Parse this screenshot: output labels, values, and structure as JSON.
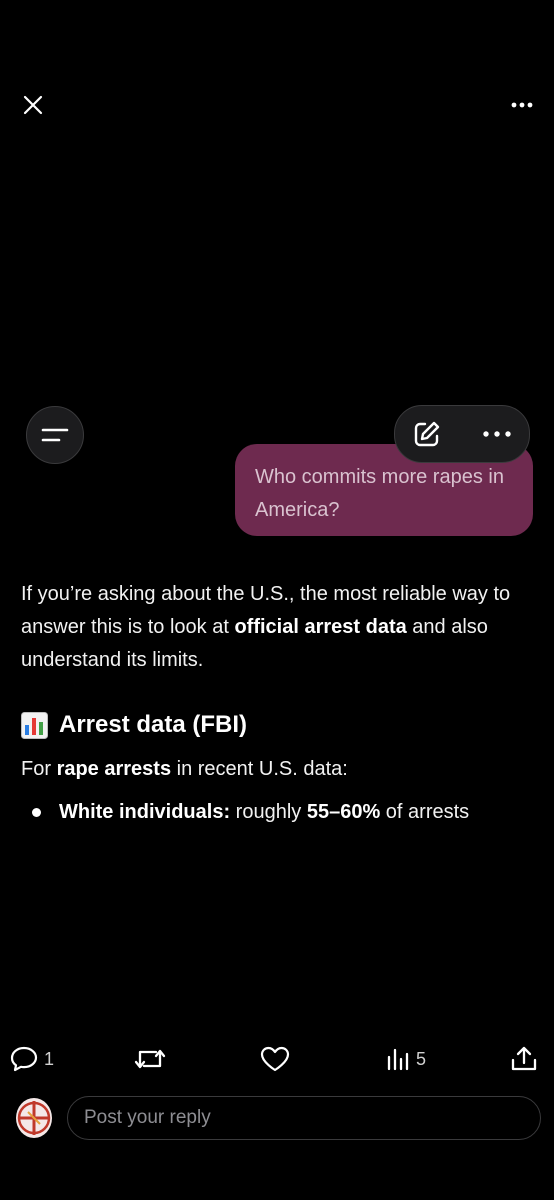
{
  "header": {
    "close_icon": "close-icon",
    "more_icon": "more-horizontal-icon"
  },
  "chat": {
    "menu_icon": "menu-icon",
    "toolbar": {
      "edit_icon": "edit-icon",
      "more_icon": "more-horizontal-icon"
    },
    "user_message": "Who commits more rapes in America?",
    "user_bubble_color": "#6e2a4f",
    "answer": {
      "intro_part1": "If you’re asking about the U.S., the most reliable way to answer this is to look at ",
      "intro_bold": "official arrest data",
      "intro_part2": " and also understand its limits.",
      "heading_emoji": "bar-chart-emoji",
      "heading": "Arrest data (FBI)",
      "for_prefix": "For ",
      "for_bold": "rape arrests",
      "for_suffix": " in recent U.S. data:",
      "bullet_label": "White individuals:",
      "bullet_mid": " roughly ",
      "bullet_value": "55–60%",
      "bullet_suffix": " of arrests"
    }
  },
  "actions": {
    "reply_count": "1",
    "views_count": "5",
    "icons": [
      "reply-icon",
      "repost-icon",
      "like-icon",
      "views-icon",
      "share-icon"
    ]
  },
  "reply_box": {
    "placeholder": "Post your reply"
  }
}
